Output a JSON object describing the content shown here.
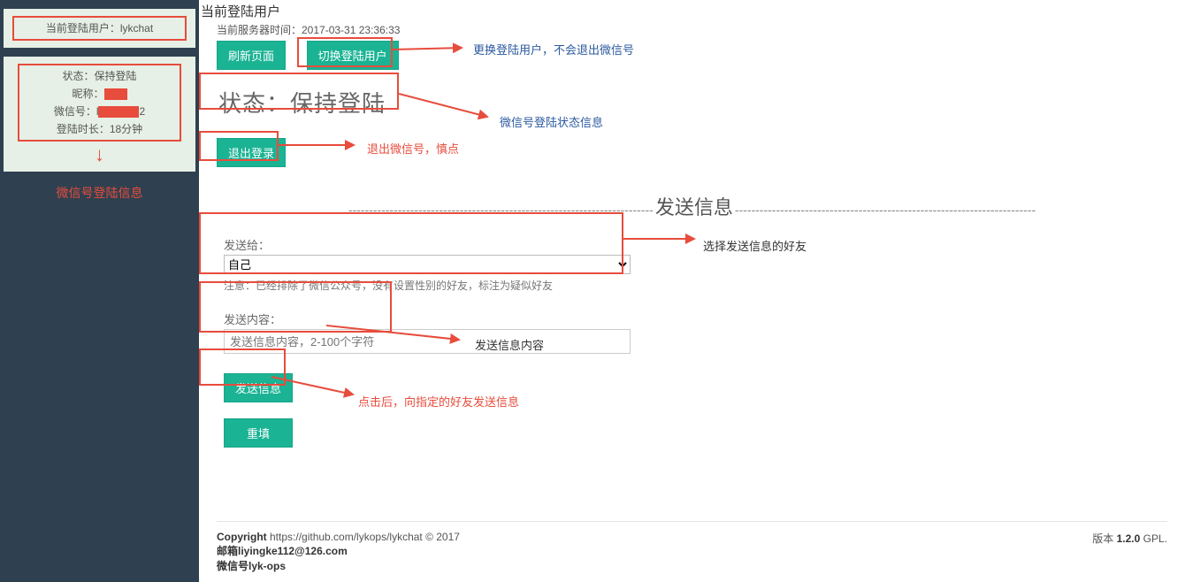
{
  "sidebar": {
    "current_user_label": "当前登陆用户：lykchat",
    "status": "状态：保持登陆",
    "nick_label": "昵称：",
    "wx_label": "微信号：l",
    "wx_suffix": "2",
    "login_time": "登陆时长：18分钟",
    "info_note": "微信号登陆信息"
  },
  "header": {
    "title": "当前登陆用户",
    "server_time": "当前服务器时间：2017-03-31 23:36:33",
    "refresh_btn": "刷新页面",
    "switch_btn": "切换登陆用户",
    "switch_note": "更换登陆用户，不会退出微信号"
  },
  "status_block": {
    "text": "状态：保持登陆",
    "note": "微信号登陆状态信息"
  },
  "logout": {
    "btn": "退出登录",
    "note": "退出微信号，慎点"
  },
  "section_title": "发送信息",
  "send_to": {
    "label": "发送给：",
    "selected": "自己",
    "note": "注意：已经排除了微信公众号，没有设置性别的好友，标注为疑似好友",
    "anno": "选择发送信息的好友"
  },
  "content": {
    "label": "发送内容：",
    "placeholder": "发送信息内容，2-100个字符",
    "anno": "发送信息内容"
  },
  "actions": {
    "send": "发送信息",
    "reset": "重填",
    "anno": "点击后，向指定的好友发送信息"
  },
  "footer": {
    "copyright_b": "Copyright",
    "copyright_rest": " https://github.com/lykops/lykchat © 2017",
    "email": "邮箱liyingke112@126.com",
    "wx": "微信号lyk-ops",
    "ver_prefix": "版本",
    "ver_b": " 1.2.0 ",
    "ver_suffix": "GPL."
  }
}
